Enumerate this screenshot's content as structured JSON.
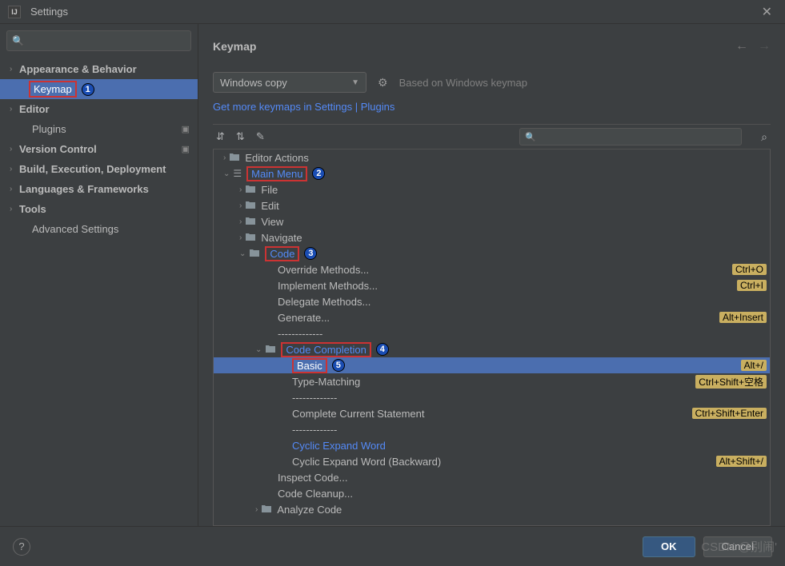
{
  "window": {
    "title": "Settings",
    "app_icon": "IJ"
  },
  "sidebar": {
    "search_placeholder": "",
    "items": [
      {
        "label": "Appearance & Behavior",
        "arrow": true,
        "bold": true
      },
      {
        "label": "Keymap",
        "child": true,
        "selected": true,
        "redbox": true,
        "badge": "1"
      },
      {
        "label": "Editor",
        "arrow": true,
        "bold": true
      },
      {
        "label": "Plugins",
        "child": true,
        "icon": true
      },
      {
        "label": "Version Control",
        "arrow": true,
        "bold": true,
        "icon": true
      },
      {
        "label": "Build, Execution, Deployment",
        "arrow": true,
        "bold": true
      },
      {
        "label": "Languages & Frameworks",
        "arrow": true,
        "bold": true
      },
      {
        "label": "Tools",
        "arrow": true,
        "bold": true
      },
      {
        "label": "Advanced Settings",
        "child": true
      }
    ]
  },
  "content": {
    "title": "Keymap",
    "dropdown": "Windows copy",
    "based": "Based on Windows keymap",
    "link": "Get more keymaps in Settings | Plugins"
  },
  "keymap_tree": [
    {
      "indent": 12,
      "arrow": "›",
      "folder": true,
      "label": "Editor Actions"
    },
    {
      "indent": 12,
      "arrow": "⌄",
      "menu": true,
      "label": "Main Menu",
      "redbox": true,
      "badge": "2",
      "link": true
    },
    {
      "indent": 32,
      "arrow": "›",
      "folder": true,
      "label": "File"
    },
    {
      "indent": 32,
      "arrow": "›",
      "folder": true,
      "label": "Edit"
    },
    {
      "indent": 32,
      "arrow": "›",
      "folder": true,
      "label": "View"
    },
    {
      "indent": 32,
      "arrow": "›",
      "folder": true,
      "label": "Navigate"
    },
    {
      "indent": 32,
      "arrow": "⌄",
      "folder": true,
      "label": "Code",
      "redbox": true,
      "badge": "3",
      "link": true
    },
    {
      "indent": 80,
      "label": "Override Methods...",
      "shortcut": "Ctrl+O"
    },
    {
      "indent": 80,
      "label": "Implement Methods...",
      "shortcut": "Ctrl+I"
    },
    {
      "indent": 80,
      "label": "Delegate Methods..."
    },
    {
      "indent": 80,
      "label": "Generate...",
      "shortcut": "Alt+Insert"
    },
    {
      "indent": 80,
      "label": "-------------"
    },
    {
      "indent": 52,
      "arrow": "⌄",
      "folder": true,
      "label": "Code Completion",
      "redbox": true,
      "badge": "4",
      "link": true
    },
    {
      "indent": 98,
      "label": "Basic",
      "shortcut": "Alt+/",
      "selected": true,
      "redbox": true,
      "badge": "5"
    },
    {
      "indent": 98,
      "label": "Type-Matching",
      "shortcut": "Ctrl+Shift+空格"
    },
    {
      "indent": 98,
      "label": "-------------"
    },
    {
      "indent": 98,
      "label": "Complete Current Statement",
      "shortcut": "Ctrl+Shift+Enter"
    },
    {
      "indent": 98,
      "label": "-------------"
    },
    {
      "indent": 98,
      "label": "Cyclic Expand Word",
      "link": true
    },
    {
      "indent": 98,
      "label": "Cyclic Expand Word (Backward)",
      "shortcut": "Alt+Shift+/"
    },
    {
      "indent": 80,
      "label": "Inspect Code..."
    },
    {
      "indent": 80,
      "label": "Code Cleanup..."
    },
    {
      "indent": 52,
      "arrow": "›",
      "folder": true,
      "label": "Analyze Code"
    }
  ],
  "footer": {
    "ok": "OK",
    "cancel": "Cancel"
  },
  "watermark": "CSDN @别闹'"
}
